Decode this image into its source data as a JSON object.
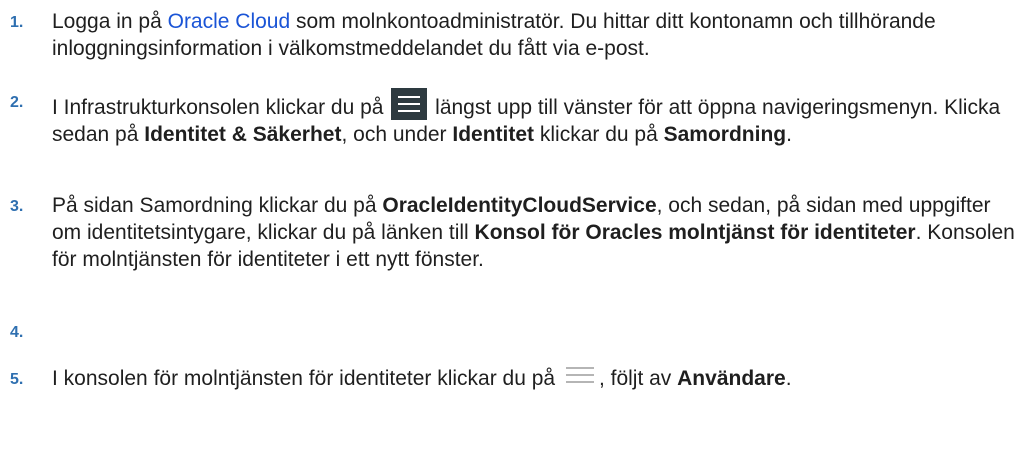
{
  "steps": [
    {
      "num": "1.",
      "t1": "Logga in på ",
      "link": "Oracle Cloud",
      "t2": " som molnkontoadministratör. Du hittar ditt kontonamn och tillhörande inloggningsinformation i välkomstmeddelandet du fått via e-post."
    },
    {
      "num": "2.",
      "t1": "I Infrastrukturkonsolen klickar du på ",
      "icon": "menu-icon",
      "t2": " längst upp till vänster för att öppna navigeringsmenyn. Klicka sedan på ",
      "b1": "Identitet & Säkerhet",
      "t3": ", och under ",
      "b2": "Identitet",
      "t4": " klickar du på ",
      "b3": "Samordning",
      "t5": "."
    },
    {
      "num": "3.",
      "t1": "På sidan Samordning klickar du på ",
      "b1": "OracleIdentityCloudService",
      "t2": ", och sedan, på sidan med uppgifter om identitetsintygare, klickar du på länken till ",
      "b2": "Konsol för Oracles molntjänst för identiteter",
      "t3": ". Konsolen för molntjänsten för identiteter i ett nytt fönster."
    },
    {
      "num": "4.",
      "text": ""
    },
    {
      "num": "5.",
      "t1": "I konsolen för molntjänsten för identiteter klickar du på ",
      "icon": "menu-icon",
      "t2": ", följt av ",
      "b1": "Användare",
      "t3": "."
    }
  ],
  "colors": {
    "step_number": "#2e6fb0",
    "link": "#1a54d6",
    "text": "#1f1f1f",
    "menu_icon_bg": "#2d3a40"
  }
}
